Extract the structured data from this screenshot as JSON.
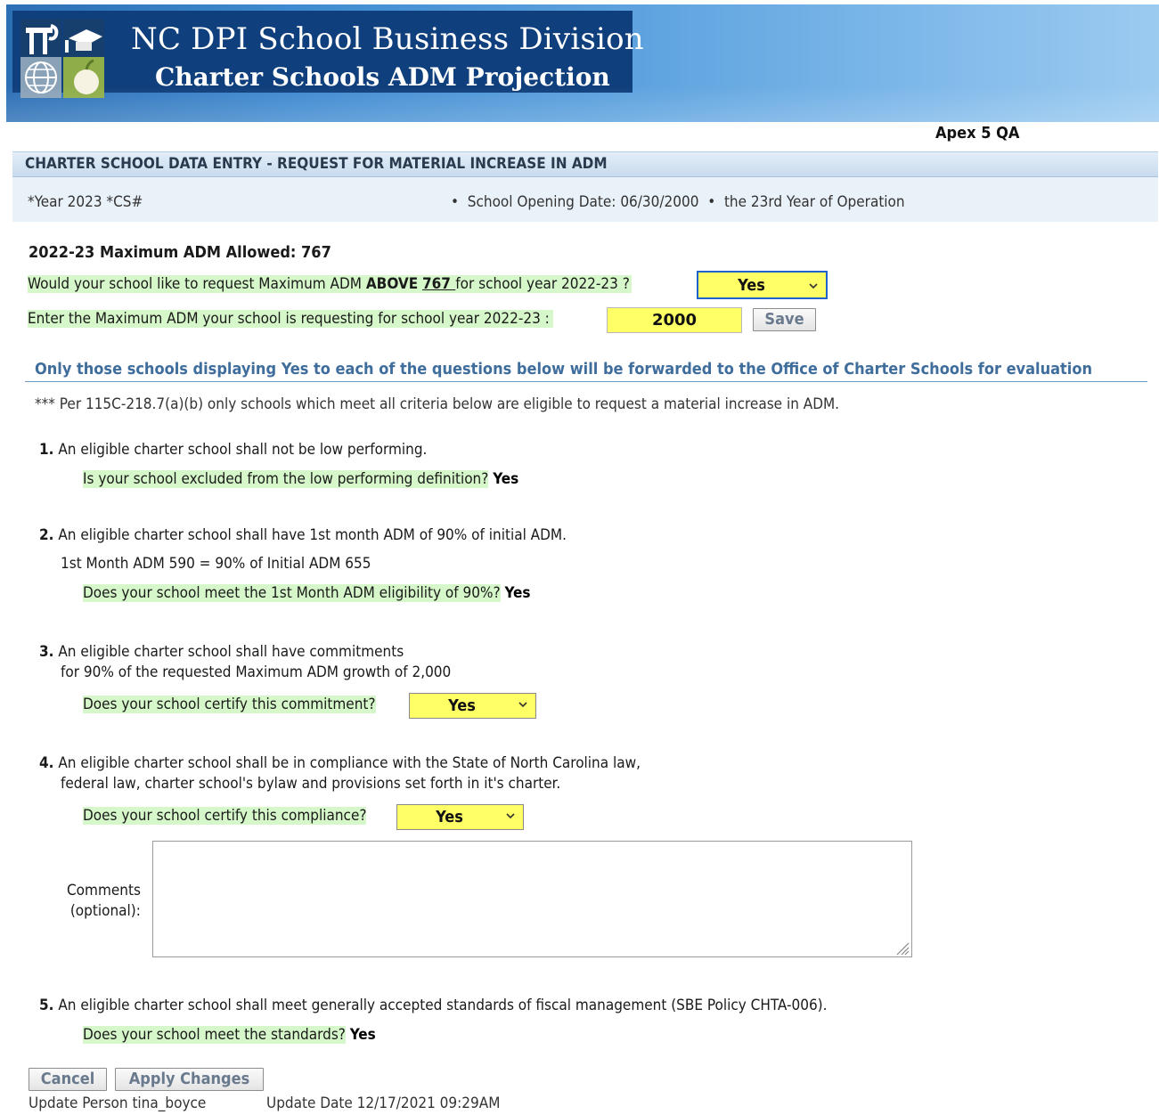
{
  "banner": {
    "title": "NC DPI School Business Division",
    "subtitle": "Charter Schools ADM Projection",
    "environment": "Apex 5 QA"
  },
  "region": {
    "title": "CHARTER SCHOOL DATA ENTRY - REQUEST FOR MATERIAL INCREASE IN ADM",
    "year_label": "*Year 2023 *CS#",
    "opening_date": "School Opening Date: 06/30/2000",
    "year_of_operation": "the 23rd Year of Operation"
  },
  "max_adm": {
    "heading": "2022-23 Maximum ADM Allowed: 767",
    "question_pre": "Would your school like to request Maximum ADM ",
    "question_above": "ABOVE",
    "question_value": "767 ",
    "question_post": "for school year 2022-23 ?",
    "request_above_select": "Yes",
    "enter_label": "Enter the Maximum ADM your school is requesting for school year 2022-23 :",
    "requested_value": "2000",
    "save_label": "Save"
  },
  "criteria": {
    "forward_note": "Only those schools displaying Yes to each of the questions below will be forwarded to the Office of Charter Schools for evaluation",
    "statute_note": "*** Per 115C-218.7(a)(b) only schools which meet all criteria below are eligible to request a material increase in ADM.",
    "c1_num": "1.",
    "c1_text": "An eligible charter school shall not be low performing.",
    "c1_question": "Is your school excluded from the low performing definition?",
    "c1_answer": "Yes",
    "c2_num": "2.",
    "c2_text": "An eligible charter school shall have 1st month ADM of 90% of initial ADM.",
    "c2_detail": "1st Month ADM 590 = 90% of Initial ADM 655",
    "c2_question": "Does your school meet the 1st Month ADM eligibility of 90%?",
    "c2_answer": "Yes",
    "c3_num": "3.",
    "c3_text_1": "An eligible charter school shall have commitments",
    "c3_text_2": "for 90% of the requested Maximum ADM growth of 2,000",
    "c3_question": "Does your school certify this commitment?",
    "c3_select": "Yes",
    "c4_num": "4.",
    "c4_text_1": "An eligible charter school shall be in compliance with the State of North Carolina law,",
    "c4_text_2": "federal law, charter school's bylaw and provisions set forth in it's charter.",
    "c4_question": "Does your school certify this compliance?",
    "c4_select": "Yes",
    "comments_label_1": "Comments",
    "comments_label_2": "(optional):",
    "comments_value": "",
    "c5_num": "5.",
    "c5_text": "An eligible charter school shall meet generally accepted standards of fiscal management (SBE Policy CHTA-006).",
    "c5_question": "Does your school meet the standards?",
    "c5_answer": "Yes"
  },
  "footer": {
    "cancel_label": "Cancel",
    "apply_label": "Apply Changes",
    "update_person": "Update Person tina_boyce",
    "update_date": "Update Date 12/17/2021 09:29AM"
  },
  "colors": {
    "banner_start": "#2c6fb5",
    "title_box": "#0f3f7c",
    "highlight_green": "#d6f7c9",
    "select_yellow": "#ffff66",
    "forward_note_blue": "#3f6d9c"
  }
}
